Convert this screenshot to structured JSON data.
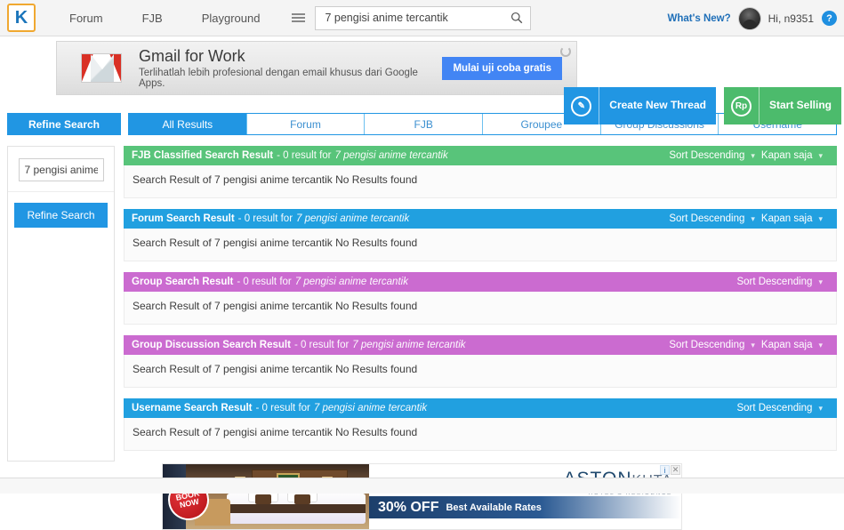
{
  "header": {
    "logo_text": "K",
    "nav": [
      {
        "label": "Forum"
      },
      {
        "label": "FJB"
      },
      {
        "label": "Playground"
      }
    ],
    "menu_icon": "hamburger-icon",
    "search": {
      "value": "7 pengisi anime tercantik",
      "placeholder": "Search...",
      "icon": "search-icon"
    },
    "whats_new": "What's New?",
    "greeting": "Hi, n9351",
    "help_icon_glyph": "?"
  },
  "promo": {
    "gmail": {
      "title": "Gmail for Work",
      "subtitle": "Terlihatlah lebih profesional dengan email khusus dari Google Apps.",
      "cta": "Mulai uji coba gratis",
      "refresh_icon": "refresh-icon"
    },
    "actions": [
      {
        "label": "Create New Thread",
        "icon_glyph": "✎",
        "color": "#2196e3"
      },
      {
        "label": "Start Selling",
        "icon_glyph": "Rp",
        "color": "#4cbb6c"
      }
    ]
  },
  "tabs": {
    "refine_label": "Refine Search",
    "items": [
      {
        "label": "All Results",
        "active": true
      },
      {
        "label": "Forum",
        "active": false
      },
      {
        "label": "FJB",
        "active": false
      },
      {
        "label": "Groupee",
        "active": false
      },
      {
        "label": "Group Discussions",
        "active": false
      },
      {
        "label": "Username",
        "active": false
      }
    ]
  },
  "sidebar": {
    "input_value": "7 pengisi anime",
    "input_placeholder": "Search keyword",
    "button_label": "Refine Search"
  },
  "results": [
    {
      "title": "FJB Classified Search Result",
      "meta": "- 0 result for",
      "query": "7 pengisi anime tercantik",
      "sort_label": "Sort Descending",
      "time_label": "Kapan saja",
      "body": "Search Result of 7 pengisi anime tercantik No Results found",
      "color": "green"
    },
    {
      "title": "Forum Search Result",
      "meta": "- 0 result for",
      "query": "7 pengisi anime tercantik",
      "sort_label": "Sort Descending",
      "time_label": "Kapan saja",
      "body": "Search Result of 7 pengisi anime tercantik No Results found",
      "color": "blue"
    },
    {
      "title": "Group Search Result",
      "meta": "- 0 result for",
      "query": "7 pengisi anime tercantik",
      "sort_label": "Sort Descending",
      "time_label": "",
      "body": "Search Result of 7 pengisi anime tercantik No Results found",
      "color": "purple"
    },
    {
      "title": "Group Discussion Search Result",
      "meta": "- 0 result for",
      "query": "7 pengisi anime tercantik",
      "sort_label": "Sort Descending",
      "time_label": "Kapan saja",
      "body": "Search Result of 7 pengisi anime tercantik No Results found",
      "color": "purple"
    },
    {
      "title": "Username Search Result",
      "meta": "- 0 result for",
      "query": "7 pengisi anime tercantik",
      "sort_label": "Sort Descending",
      "time_label": "",
      "body": "Search Result of 7 pengisi anime tercantik No Results found",
      "color": "blue"
    }
  ],
  "bottom_ad": {
    "book_now": "BOOK NOW",
    "brand_main": "ASTON",
    "brand_sub": "KUTA",
    "brand_tagline": "HOTEL & RESIDENCE",
    "discount": "30% OFF",
    "rates": "Best Available Rates",
    "info_icon": "info-icon",
    "close_icon": "close-icon"
  },
  "colors": {
    "accent_blue": "#2196e3",
    "green": "#58c47a",
    "purple": "#cb6bd0",
    "logo_orange": "#f0a830"
  }
}
